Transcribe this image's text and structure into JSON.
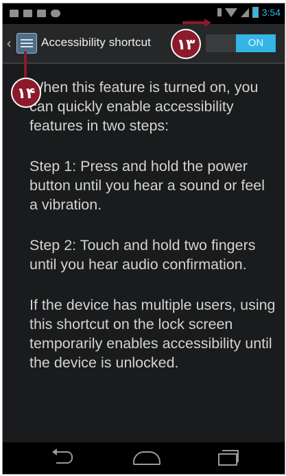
{
  "status_bar": {
    "time": "3:54",
    "left_icons": [
      "picture-icon",
      "mail-icon",
      "briefcase-icon",
      "chat-icon"
    ],
    "right_icons": [
      "bluetooth-icon",
      "wifi-icon",
      "signal-icon",
      "battery-icon"
    ]
  },
  "action_bar": {
    "back_icon": "chevron-left-icon",
    "app_icon": "accessibility-settings-icon",
    "title": "Accessibility shortcut",
    "toggle_label": "ON",
    "toggle_state": "on"
  },
  "callouts": {
    "toggle_badge": "۱۳",
    "icon_badge": "۱۴"
  },
  "content": {
    "paragraphs": [
      "When this feature is turned on, you can quickly enable accessibility features in two steps:",
      "Step 1: Press and hold the power button until you hear a sound or feel a vibration.",
      "Step 2: Touch and hold two fingers until you hear audio confirmation.",
      "If the device has multiple users, using this shortcut on the lock screen temporarily enables accessibility until the device is unlocked."
    ]
  },
  "nav_bar": {
    "buttons": [
      "back-icon",
      "home-icon",
      "recent-apps-icon"
    ]
  },
  "colors": {
    "accent": "#33b5e5",
    "callout": "#8b1b2b",
    "background": "#1a1b1c"
  }
}
